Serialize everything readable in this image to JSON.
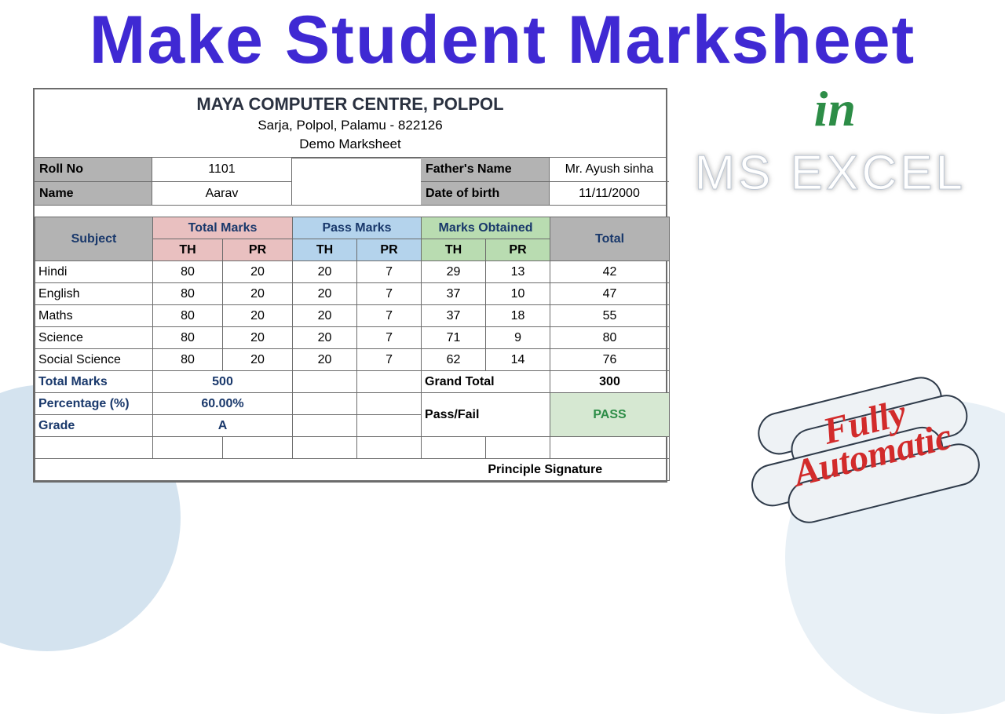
{
  "title": {
    "main": "Make Student Marksheet",
    "in": "in",
    "excel": "MS EXCEL"
  },
  "badge": {
    "line1": "Fully",
    "line2": "Automatic"
  },
  "sheet": {
    "header": {
      "org": "MAYA COMPUTER CENTRE, POLPOL",
      "address": "Sarja, Polpol, Palamu - 822126",
      "type": "Demo Marksheet"
    },
    "info": {
      "roll_label": "Roll No",
      "roll_value": "1101",
      "name_label": "Name",
      "name_value": "Aarav",
      "father_label": "Father's Name",
      "father_value": "Mr. Ayush sinha",
      "dob_label": "Date of birth",
      "dob_value": "11/11/2000"
    },
    "columns": {
      "subject": "Subject",
      "total_marks": "Total Marks",
      "pass_marks": "Pass Marks",
      "marks_obtained": "Marks Obtained",
      "total": "Total",
      "th": "TH",
      "pr": "PR"
    },
    "rows": [
      {
        "subject": "Hindi",
        "tm_th": 80,
        "tm_pr": 20,
        "pm_th": 20,
        "pm_pr": 7,
        "mo_th": 29,
        "mo_pr": 13,
        "total": 42
      },
      {
        "subject": "English",
        "tm_th": 80,
        "tm_pr": 20,
        "pm_th": 20,
        "pm_pr": 7,
        "mo_th": 37,
        "mo_pr": 10,
        "total": 47
      },
      {
        "subject": "Maths",
        "tm_th": 80,
        "tm_pr": 20,
        "pm_th": 20,
        "pm_pr": 7,
        "mo_th": 37,
        "mo_pr": 18,
        "total": 55
      },
      {
        "subject": "Science",
        "tm_th": 80,
        "tm_pr": 20,
        "pm_th": 20,
        "pm_pr": 7,
        "mo_th": 71,
        "mo_pr": 9,
        "total": 80
      },
      {
        "subject": "Social Science",
        "tm_th": 80,
        "tm_pr": 20,
        "pm_th": 20,
        "pm_pr": 7,
        "mo_th": 62,
        "mo_pr": 14,
        "total": 76
      }
    ],
    "summary": {
      "total_marks_label": "Total Marks",
      "total_marks_value": "500",
      "grand_total_label": "Grand Total",
      "grand_total_value": "300",
      "percentage_label": "Percentage (%)",
      "percentage_value": "60.00%",
      "passfail_label": "Pass/Fail",
      "passfail_value": "PASS",
      "grade_label": "Grade",
      "grade_value": "A",
      "signature": "Principle Signature"
    }
  }
}
